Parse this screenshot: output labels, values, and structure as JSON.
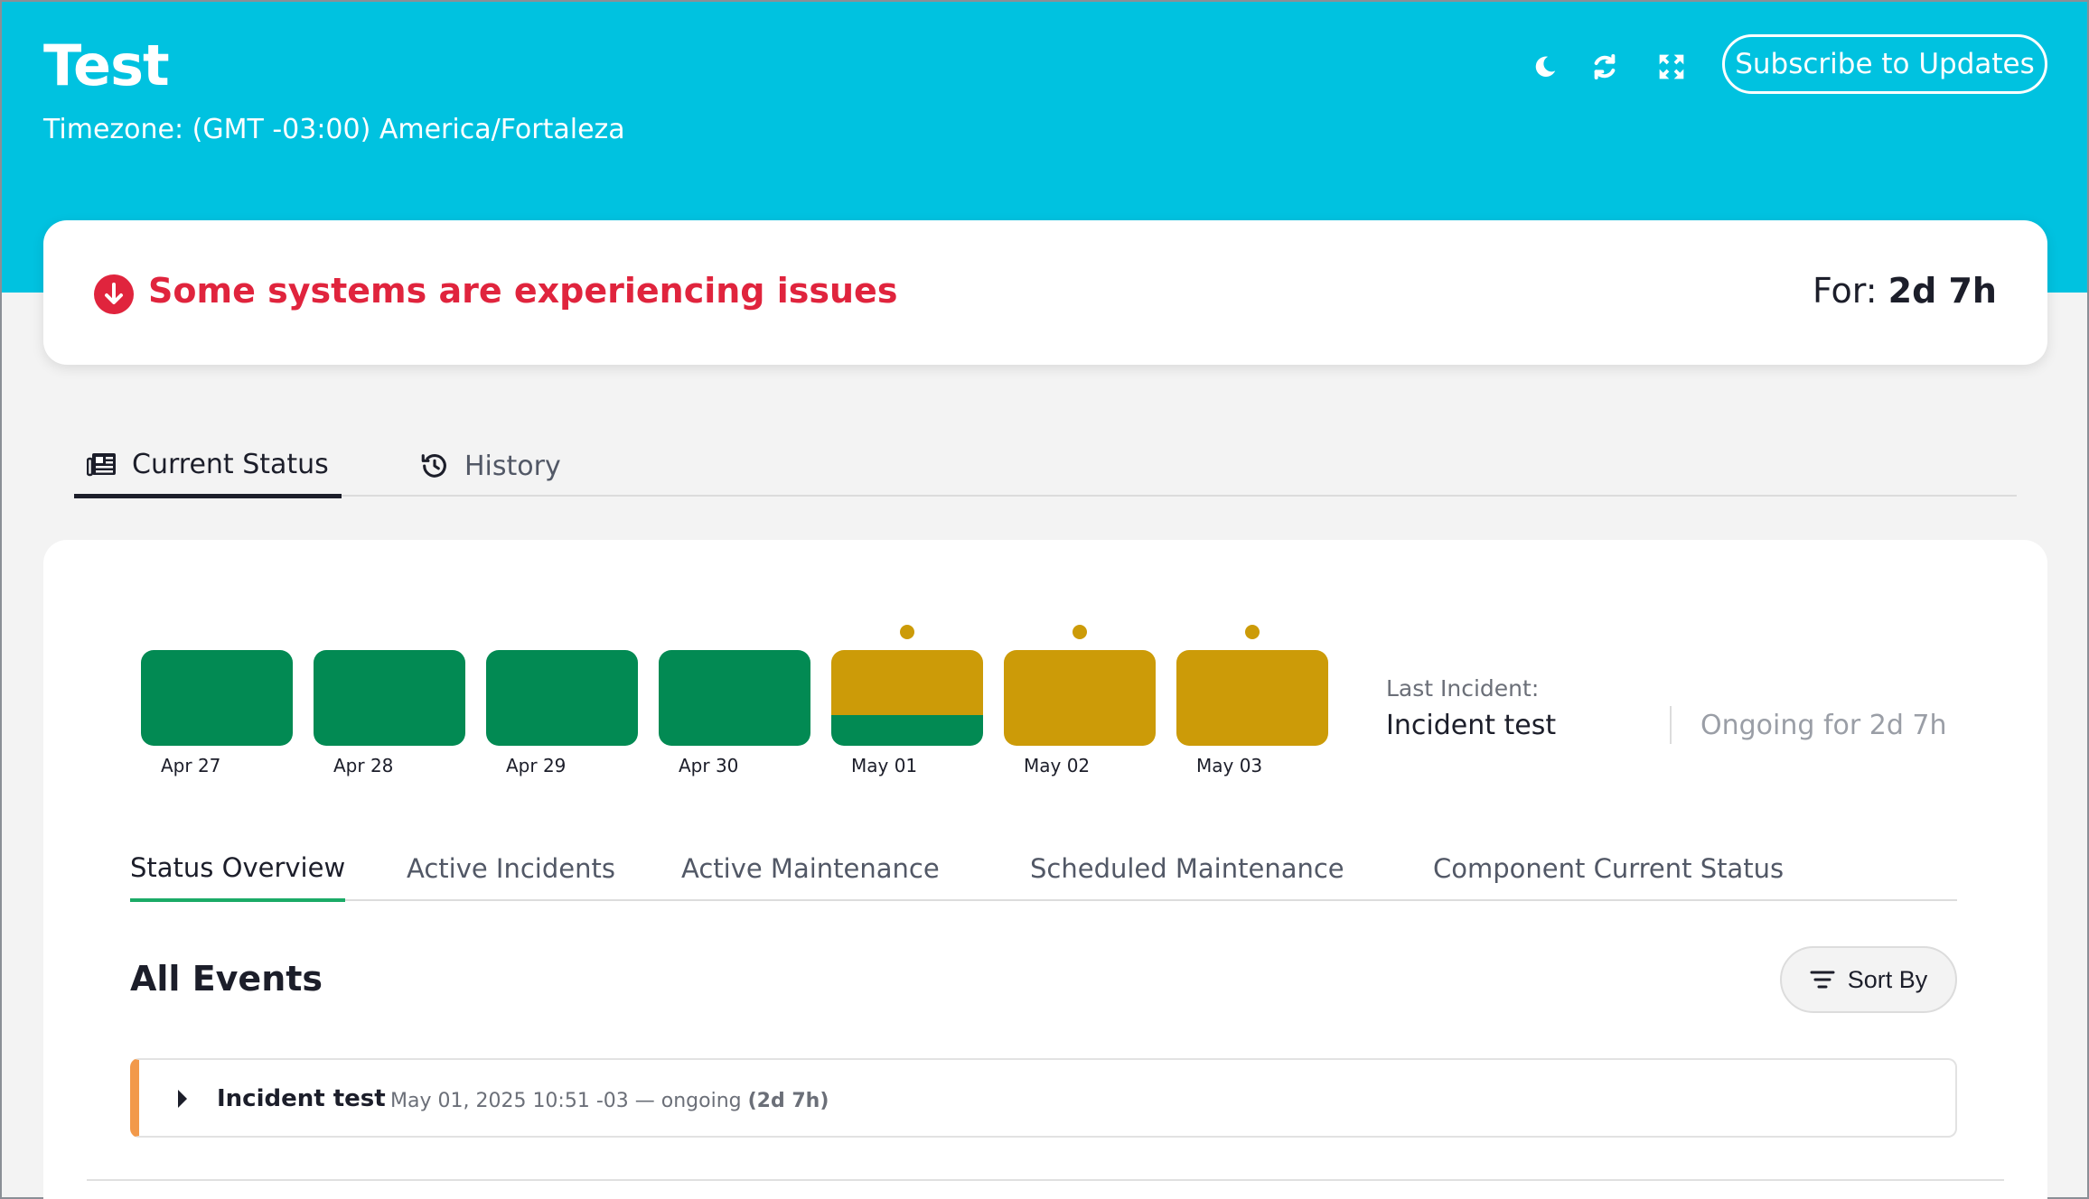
{
  "header": {
    "title": "Test",
    "timezone": "Timezone: (GMT -03:00) America/Fortaleza",
    "icons": [
      "moon-icon",
      "refresh-icon",
      "fullscreen-icon"
    ],
    "subscribe_label": "Subscribe to Updates",
    "background_color": "#00c2e0"
  },
  "banner": {
    "message": "Some systems are experiencing issues",
    "for_label": "For: ",
    "for_value": "2d 7h",
    "status_color": "#e0243d",
    "icon": "arrow-down-circle-icon"
  },
  "page_tabs": [
    {
      "label": "Current Status",
      "icon": "newspaper-icon",
      "active": true
    },
    {
      "label": "History",
      "icon": "history-icon",
      "active": false
    }
  ],
  "timeline": {
    "days": [
      {
        "label": "Apr 27",
        "status": "operational",
        "has_incident": false
      },
      {
        "label": "Apr 28",
        "status": "operational",
        "has_incident": false
      },
      {
        "label": "Apr 29",
        "status": "operational",
        "has_incident": false
      },
      {
        "label": "Apr 30",
        "status": "operational",
        "has_incident": false
      },
      {
        "label": "May 01",
        "status": "partial",
        "has_incident": true
      },
      {
        "label": "May 02",
        "status": "degraded",
        "has_incident": true
      },
      {
        "label": "May 03",
        "status": "degraded",
        "has_incident": true
      }
    ],
    "colors": {
      "operational": "#028a53",
      "degraded": "#cc9b08"
    }
  },
  "last_incident": {
    "label": "Last Incident:",
    "name": "Incident test",
    "ongoing": "Ongoing for 2d 7h"
  },
  "sub_tabs": [
    {
      "label": "Status Overview",
      "active": true
    },
    {
      "label": "Active Incidents",
      "active": false
    },
    {
      "label": "Active Maintenance",
      "active": false
    },
    {
      "label": "Scheduled Maintenance",
      "active": false
    },
    {
      "label": "Component Current Status",
      "active": false
    }
  ],
  "events": {
    "heading": "All Events",
    "sort_label": "Sort By",
    "items": [
      {
        "title": "Incident test",
        "time": "May 01, 2025 10:51 -03 — ongoing ",
        "duration": "(2d 7h)",
        "accent_color": "#f2994a"
      }
    ]
  }
}
